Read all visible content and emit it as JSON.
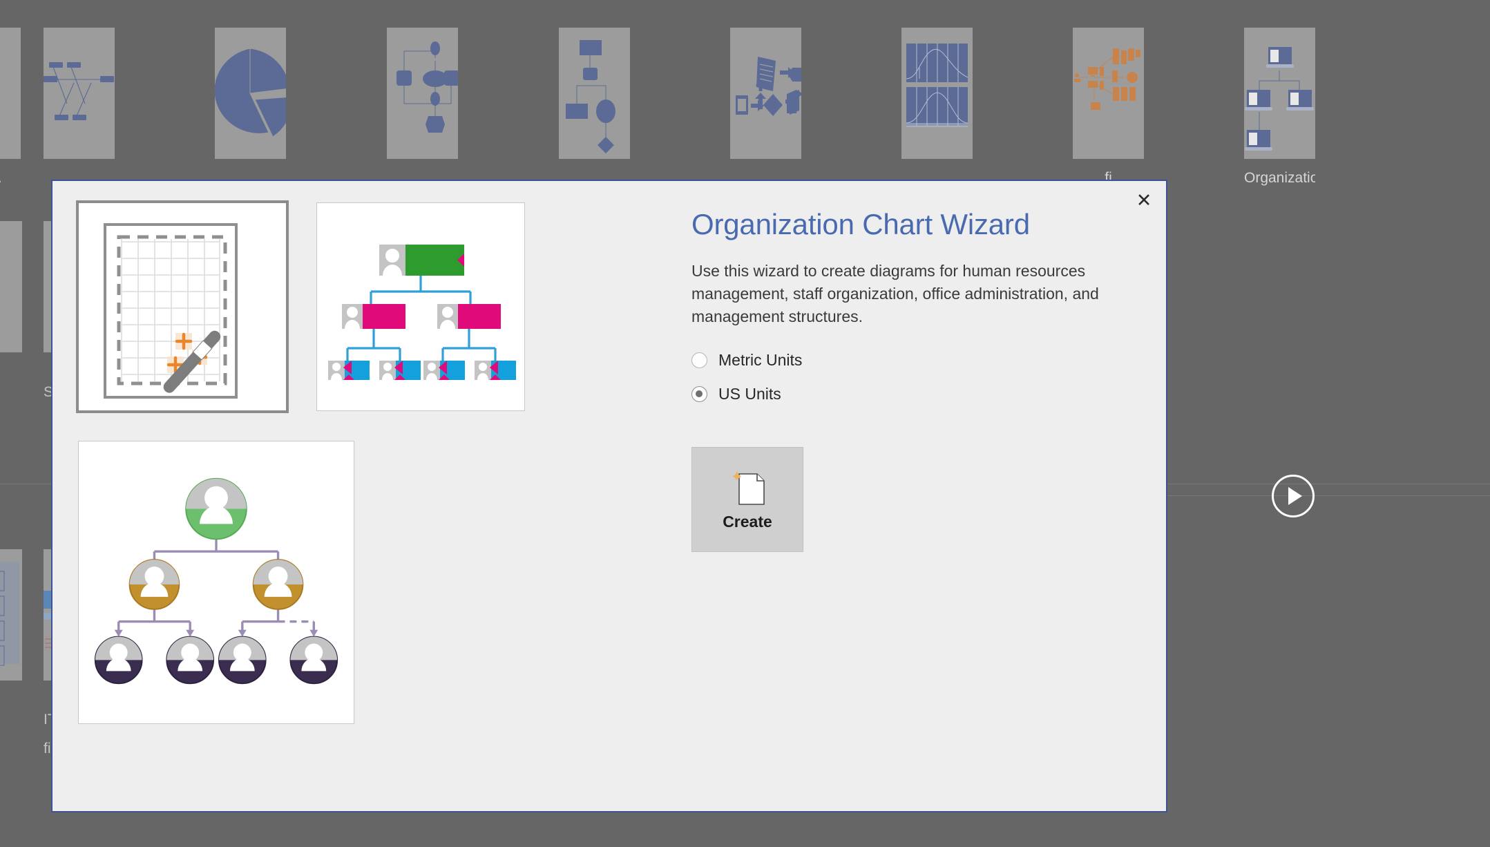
{
  "background": {
    "gallery_templates": [
      {
        "name": "cause-effect-diagram",
        "label": "C..."
      },
      {
        "name": "pie-chart-template",
        "label": ""
      },
      {
        "name": "block-diagram-template",
        "label": ""
      },
      {
        "name": "basic-flowchart-template",
        "label": ""
      },
      {
        "name": "work-flow-diagram-template",
        "label": ""
      },
      {
        "name": "normal-curve-chart-template",
        "label": ""
      },
      {
        "name": "detailed-network-diagram-template",
        "label": "...fi..."
      },
      {
        "name": "organization-chart-template",
        "label": "Organization Ch..."
      }
    ],
    "left_edge_labels": [
      "S",
      "IT",
      "fi"
    ],
    "next_button": "next-arrow"
  },
  "dialog": {
    "close_label": "✕",
    "title": "Organization Chart Wizard",
    "description": "Use this wizard to create diagrams for human resources management, staff organization, office administration, and management structures.",
    "units_options": [
      {
        "label": "Metric Units",
        "selected": false
      },
      {
        "label": "US Units",
        "selected": true
      }
    ],
    "create_button_label": "Create",
    "previews": [
      {
        "name": "wizard-grid-preview",
        "selected": true
      },
      {
        "name": "org-chart-colored-preview",
        "selected": false
      },
      {
        "name": "org-chart-circles-preview",
        "selected": false
      }
    ]
  },
  "colors": {
    "title_blue": "#4a6ab0",
    "dialog_border": "#3f5294",
    "dialog_bg": "#eeeeee",
    "page_bg": "#666666",
    "thumb_bg": "#9c9c9c",
    "thumb_shape": "#5b6b95",
    "network_orange": "#c8834a",
    "org_green": "#2e9b2e",
    "org_magenta": "#e00a7a",
    "org_blue": "#14a0dc",
    "circle_green": "#6cbf6c",
    "circle_gold": "#c2912e",
    "circle_purple": "#3b2d50",
    "connector_purple": "#9b8cb4",
    "wand_orange": "#e8862b",
    "create_sparkle": "#f0b05e"
  }
}
